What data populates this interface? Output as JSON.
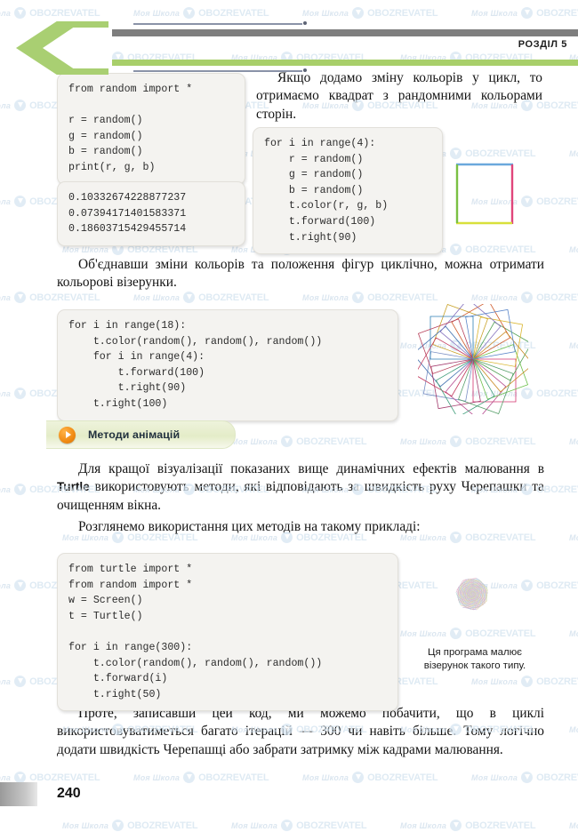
{
  "header": {
    "chapter_label": "РОЗДІЛ 5",
    "chevron_icon": "chevron-left-icon"
  },
  "watermarks": {
    "school_text": "Моя Школа",
    "oboz_text": "OBOZREVATEL",
    "logo_icon": "play-circle-logo"
  },
  "content": {
    "code_block_1": "from random import *\n\nr = random()\ng = random()\nb = random()\nprint(r, g, b)",
    "output_block": "0.10332674228877237\n0.07394171401583371\n0.18603715429455714",
    "paragraph_1": "Якщо додамо зміну кольорів у цикл, то отримаємо квадрат з рандомними кольорами сторін.",
    "code_block_2": "for i in range(4):\n    r = random()\n    g = random()\n    b = random()\n    t.color(r, g, b)\n    t.forward(100)\n    t.right(90)",
    "paragraph_2": "Об'єднавши зміни кольорів та положення фігур циклічно, можна отримати кольорові візерунки.",
    "code_block_3": "for i in range(18):\n    t.color(random(), random(), random())\n    for i in range(4):\n        t.forward(100)\n        t.right(90)\n    t.right(100)",
    "section_heading": "Методи анімацій",
    "paragraph_3_part1": "Для кращої візуалізації показаних вище динамічних ефектів малювання в ",
    "paragraph_3_bold": "Turtle",
    "paragraph_3_part2": " використовують методи, які відповідають за швидкість руху Черепашки та очищенням вікна.",
    "paragraph_4": "Розглянемо використання цих методів на такому прикладі:",
    "code_block_4": "from turtle import *\nfrom random import *\nw = Screen()\nt = Turtle()\n\nfor i in range(300):\n    t.color(random(), random(), random())\n    t.forward(i)\n    t.right(50)",
    "figure_caption": "Ця програма малює візерунок такого типу.",
    "paragraph_5": "Проте, записавши цей код, ми можемо побачити, що в циклі використовуватиметься багато ітерацій — 300 чи навіть більше. Тому логічно додати швидкість Черепашці або забрати затримку між кадрами малювання."
  },
  "figures": {
    "square": {
      "name": "colored-square-figure",
      "sides": [
        {
          "side": "top",
          "color": "#6aa8dc"
        },
        {
          "side": "right",
          "color": "#e0457b"
        },
        {
          "side": "bottom",
          "color": "#d8e03a"
        },
        {
          "side": "left",
          "color": "#7ac043"
        }
      ]
    },
    "rosette": {
      "name": "rotated-squares-rosette-figure",
      "count": 18,
      "rotation_step_deg": 100,
      "colors": [
        "#d4336f",
        "#7a8fc4",
        "#c9a22a",
        "#4f9e52",
        "#b44a8e",
        "#3f6fae",
        "#cf5a2a",
        "#6bbf4a",
        "#a33b6d",
        "#2f7fb5",
        "#d9b52f",
        "#58a06b",
        "#c23a5e",
        "#8470bd",
        "#c98a24",
        "#3f9d7a",
        "#b7425c",
        "#5b86c9"
      ]
    },
    "spiral": {
      "name": "pale-spiral-figure",
      "turns": 300,
      "angle_step_deg": 50
    }
  },
  "footer": {
    "page_number": "240"
  }
}
